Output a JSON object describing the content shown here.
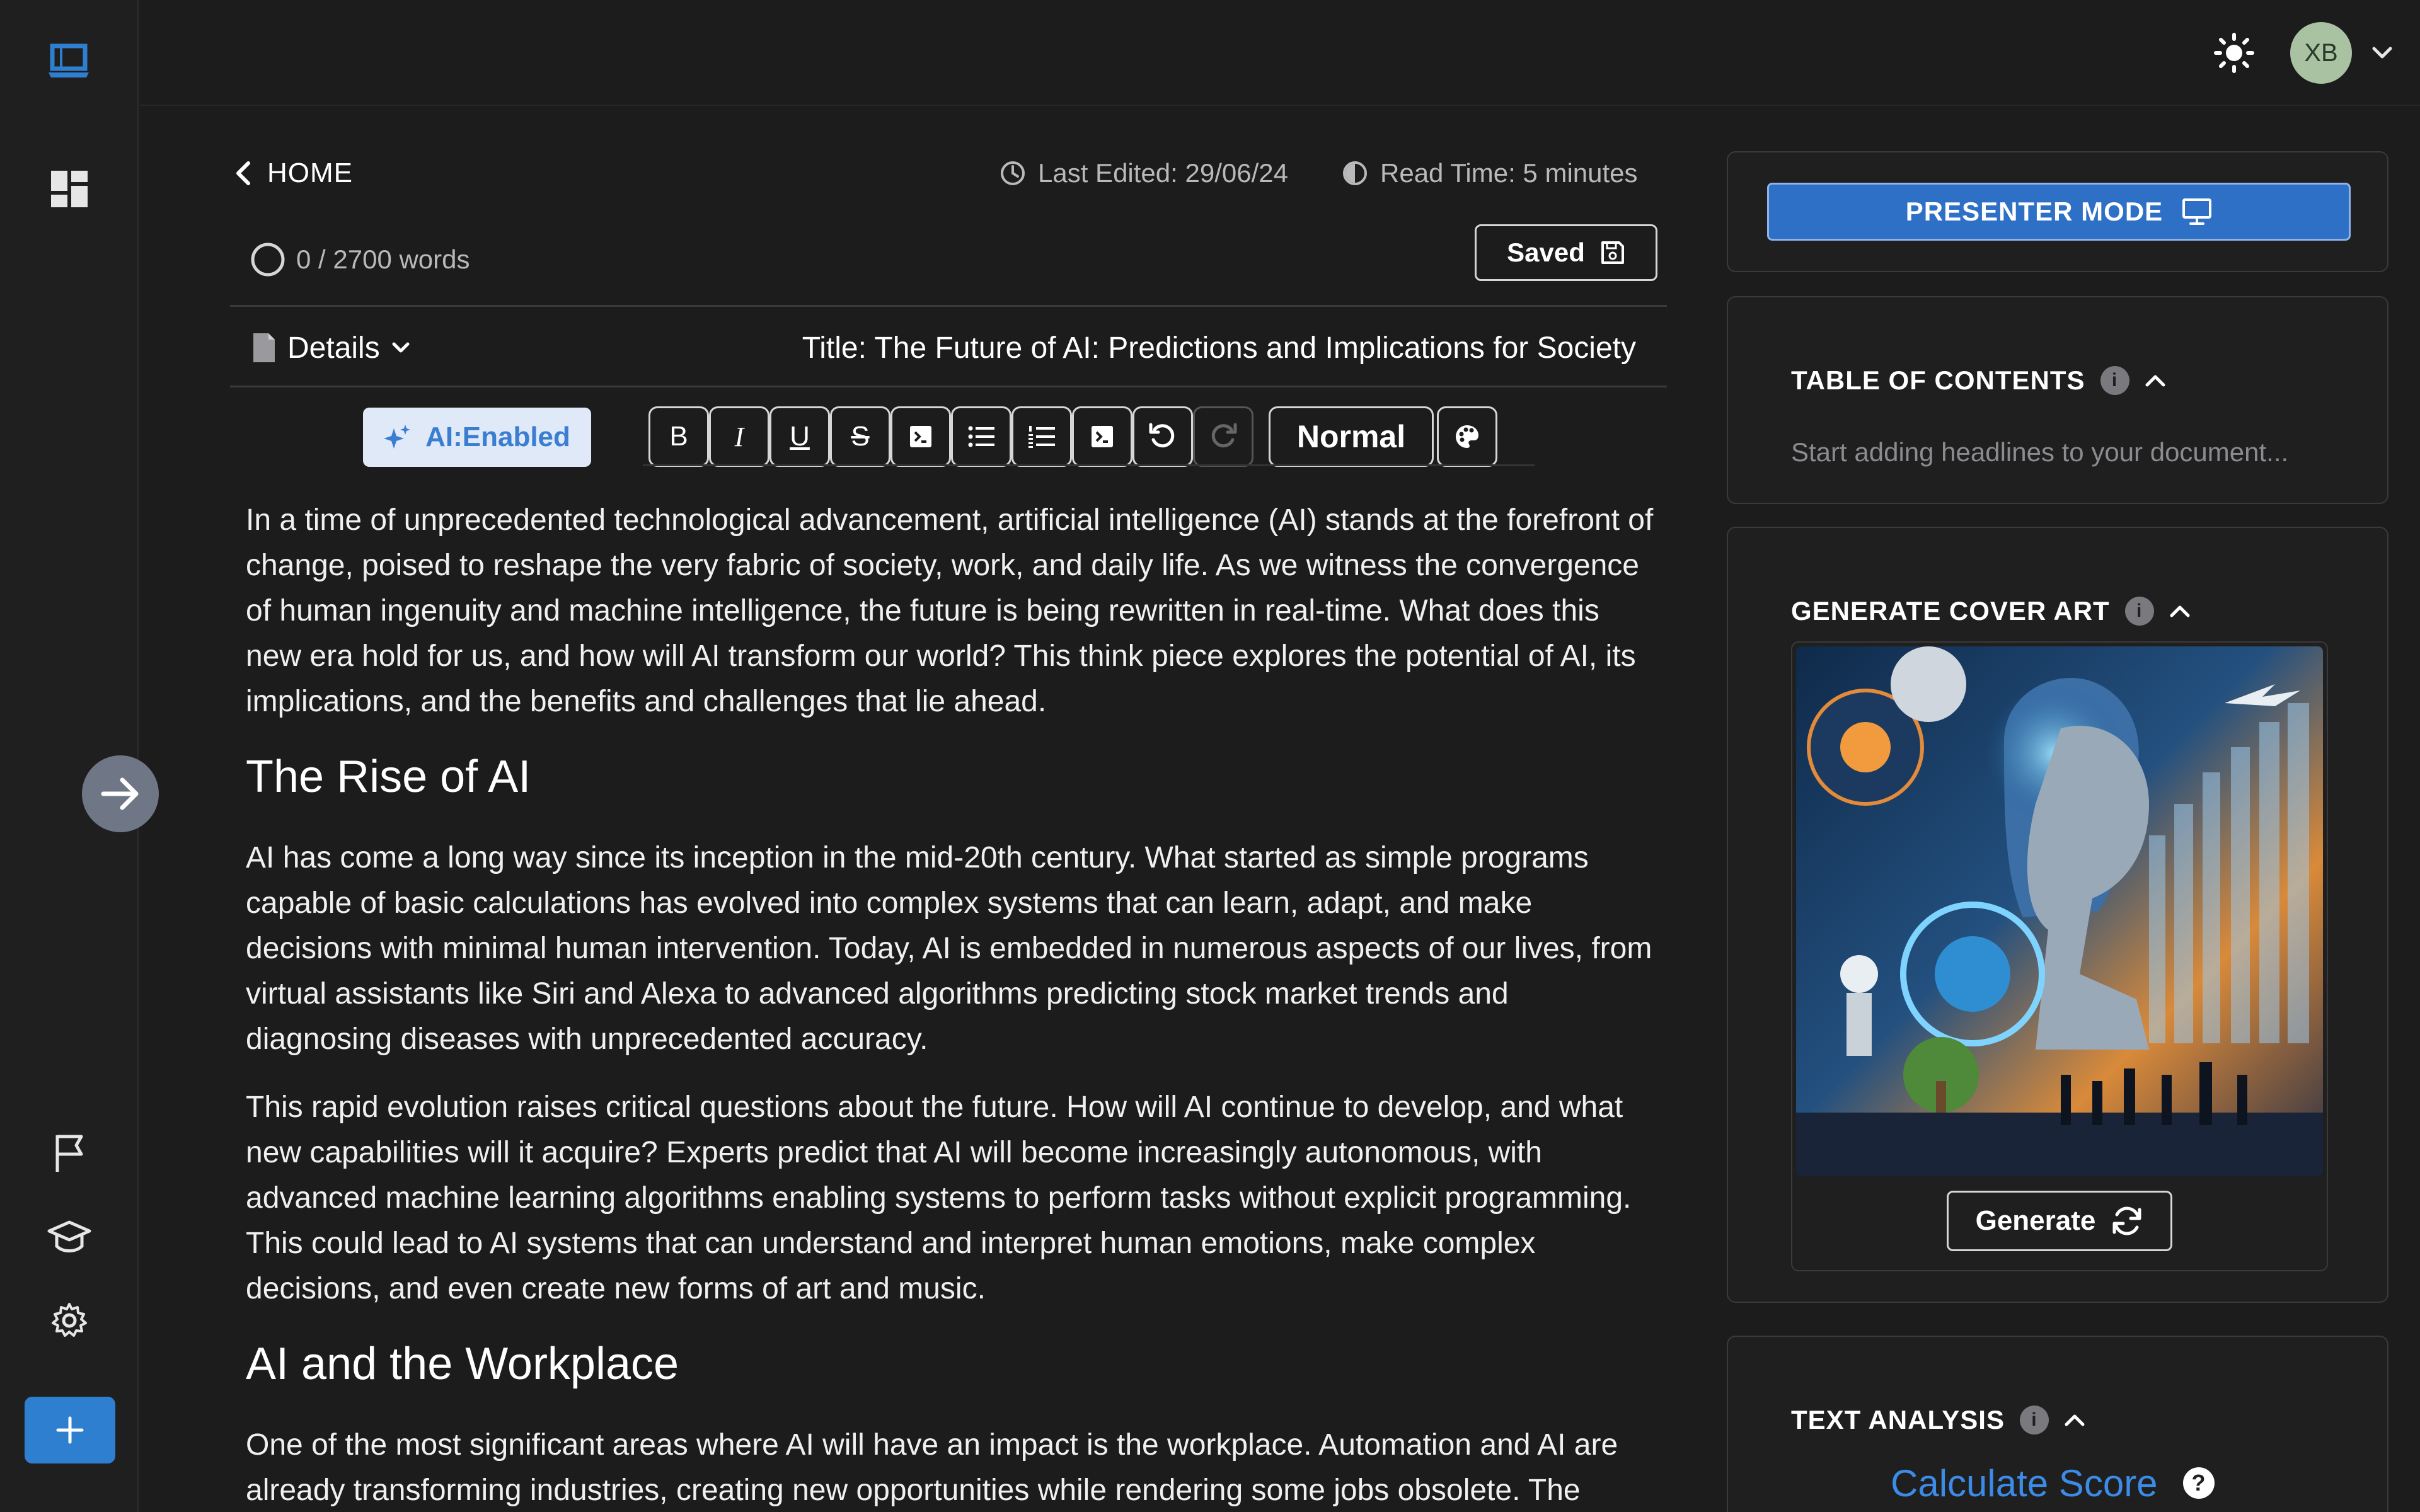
{
  "topbar": {
    "avatar_initials": "XB"
  },
  "nav": {
    "back_label": "HOME",
    "last_edited": "Last Edited: 29/06/24",
    "read_time": "Read Time: 5 minutes",
    "word_count": "0 / 2700 words",
    "saved_label": "Saved"
  },
  "document": {
    "details_label": "Details",
    "title": "Title: The Future of AI: Predictions and Implications for Society"
  },
  "toolbar": {
    "ai_label": "AI:Enabled",
    "bold": "B",
    "italic": "I",
    "underline": "U",
    "strike": "S",
    "style_value": "Normal"
  },
  "content": {
    "p1": "In a time of unprecedented technological advancement, artificial intelligence (AI) stands at the forefront of change, poised to reshape the very fabric of society, work, and daily life. As we witness the convergence of human ingenuity and machine intelligence, the future is being rewritten in real-time. What does this new era hold for us, and how will AI transform our world? This think piece explores the potential of AI, its implications, and the benefits and challenges that lie ahead.",
    "h1": "The Rise of AI",
    "p2": "AI has come a long way since its inception in the mid-20th century. What started as simple programs capable of basic calculations has evolved into complex systems that can learn, adapt, and make decisions with minimal human intervention. Today, AI is embedded in numerous aspects of our lives, from virtual assistants like Siri and Alexa to advanced algorithms predicting stock market trends and diagnosing diseases with unprecedented accuracy.",
    "p3": "This rapid evolution raises critical questions about the future. How will AI continue to develop, and what new capabilities will it acquire? Experts predict that AI will become increasingly autonomous, with advanced machine learning algorithms enabling systems to perform tasks without explicit programming. This could lead to AI systems that can understand and interpret human emotions, make complex decisions, and even create new forms of art and music.",
    "h2": "AI and the Workplace",
    "p4": "One of the most significant areas where AI will have an impact is the workplace. Automation and AI are already transforming industries, creating new opportunities while rendering some jobs obsolete. The"
  },
  "panels": {
    "presenter_label": "PRESENTER MODE",
    "toc_title": "TABLE OF CONTENTS",
    "toc_placeholder": "Start adding headlines to your document...",
    "cover_title": "GENERATE COVER ART",
    "generate_label": "Generate",
    "analysis_title": "TEXT ANALYSIS",
    "calc_label": "Calculate Score",
    "info_glyph": "i",
    "help_glyph": "?"
  },
  "colors": {
    "accent_blue": "#2e70c6",
    "link_blue": "#3c8be6",
    "background": "#1c1c1d"
  }
}
